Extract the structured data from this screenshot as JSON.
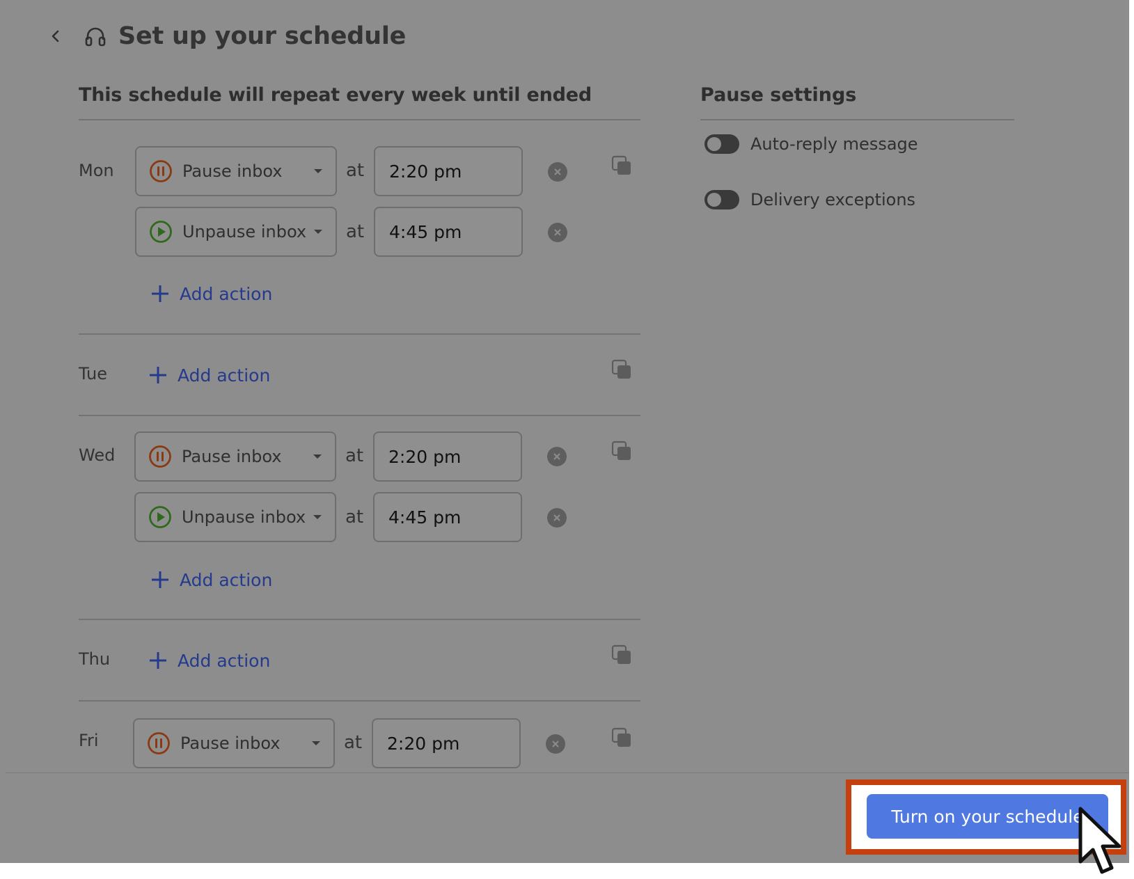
{
  "header": {
    "title": "Set up your schedule"
  },
  "schedule": {
    "heading": "This schedule will repeat every week until ended",
    "days": {
      "mon": {
        "label": "Mon",
        "actions": [
          {
            "type": "Pause inbox",
            "at": "at",
            "time": "2:20 pm"
          },
          {
            "type": "Unpause inbox",
            "at": "at",
            "time": "4:45 pm"
          }
        ],
        "add_action": "Add action"
      },
      "tue": {
        "label": "Tue",
        "add_action": "Add action"
      },
      "wed": {
        "label": "Wed",
        "actions": [
          {
            "type": "Pause inbox",
            "at": "at",
            "time": "2:20 pm"
          },
          {
            "type": "Unpause inbox",
            "at": "at",
            "time": "4:45 pm"
          }
        ],
        "add_action": "Add action"
      },
      "thu": {
        "label": "Thu",
        "add_action": "Add action"
      },
      "fri": {
        "label": "Fri",
        "actions": [
          {
            "type": "Pause inbox",
            "at": "at",
            "time": "2:20 pm"
          }
        ]
      }
    }
  },
  "pause_settings": {
    "title": "Pause settings",
    "toggles": [
      {
        "label": "Auto-reply message",
        "on": false
      },
      {
        "label": "Delivery exceptions",
        "on": false
      }
    ]
  },
  "footer": {
    "primary_button": "Turn on your schedule"
  },
  "colors": {
    "overlay": "#8d8d8d",
    "primary": "#4f78e0",
    "highlight": "#c4400e",
    "pause_icon": "#8a3a12",
    "unpause_icon": "#2f6a1c",
    "link": "#253a8c"
  },
  "icons": [
    "back-icon",
    "headset-icon",
    "pause-icon",
    "play-icon",
    "chevron-down-icon",
    "clear-icon",
    "copy-icon",
    "plus-icon",
    "cursor-icon"
  ]
}
